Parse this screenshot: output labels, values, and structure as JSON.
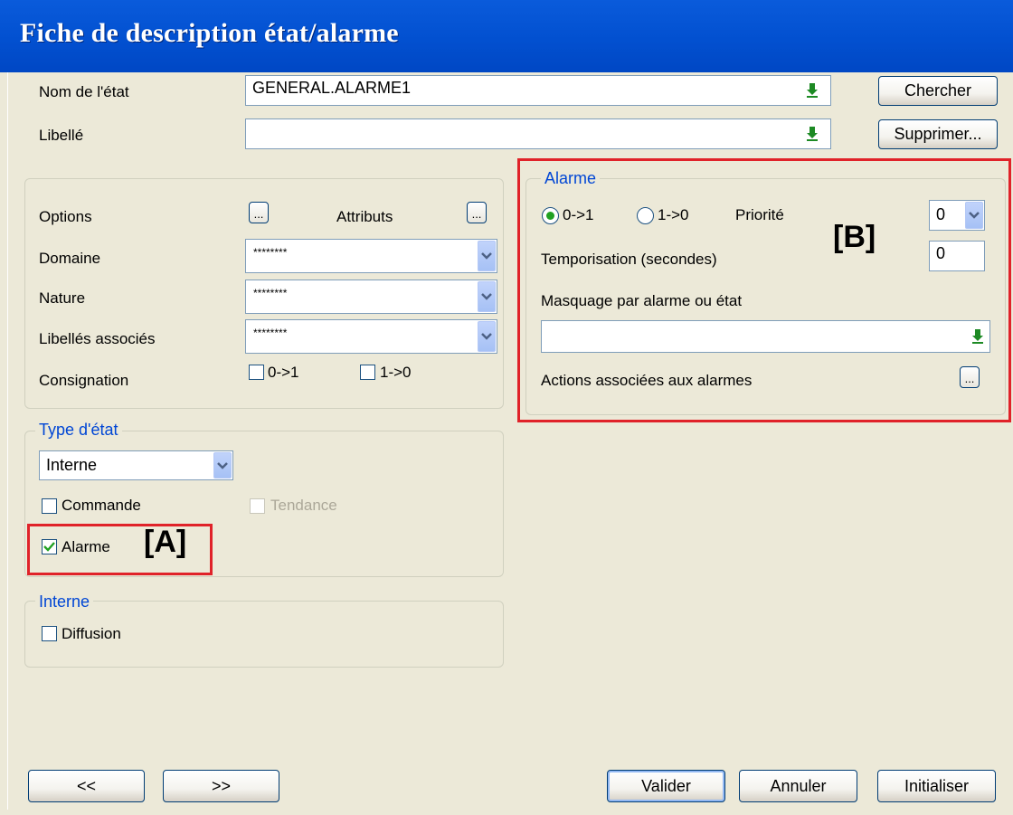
{
  "window": {
    "title": "Fiche de description état/alarme"
  },
  "top": {
    "nom_label": "Nom de l'état",
    "nom_value": "GENERAL.ALARME1",
    "libelle_label": "Libellé",
    "libelle_value": "",
    "chercher": "Chercher",
    "supprimer": "Supprimer..."
  },
  "options_panel": {
    "options_label": "Options",
    "attributs_label": "Attributs",
    "dots": "...",
    "domaine_label": "Domaine",
    "domaine_value": "********",
    "nature_label": "Nature",
    "nature_value": "********",
    "libelles_label": "Libellés associés",
    "libelles_value": "********",
    "consignation_label": "Consignation",
    "cons_0_1": "0->1",
    "cons_1_0": "1->0"
  },
  "type_etat": {
    "title": "Type d'état",
    "select_value": "Interne",
    "commande": "Commande",
    "tendance": "Tendance",
    "alarme": "Alarme",
    "alarme_checked": true,
    "tag": "[A]"
  },
  "interne": {
    "title": "Interne",
    "diffusion": "Diffusion"
  },
  "alarme_group": {
    "title": "Alarme",
    "radio_0_1": "0->1",
    "radio_1_0": "1->0",
    "selected": "0->1",
    "priorite_label": "Priorité",
    "priorite_value": "0",
    "tempo_label": "Temporisation (secondes)",
    "tempo_value": "0",
    "masquage_label": "Masquage par alarme ou état",
    "masquage_value": "",
    "actions_label": "Actions associées aux alarmes",
    "tag": "[B]"
  },
  "footer": {
    "prev": "<<",
    "next": ">>",
    "valider": "Valider",
    "annuler": "Annuler",
    "initialiser": "Initialiser"
  },
  "colors": {
    "titlebar": "#0250D0",
    "group_title": "#0046D5",
    "highlight": "#E02229",
    "face": "#ECE9D8"
  }
}
